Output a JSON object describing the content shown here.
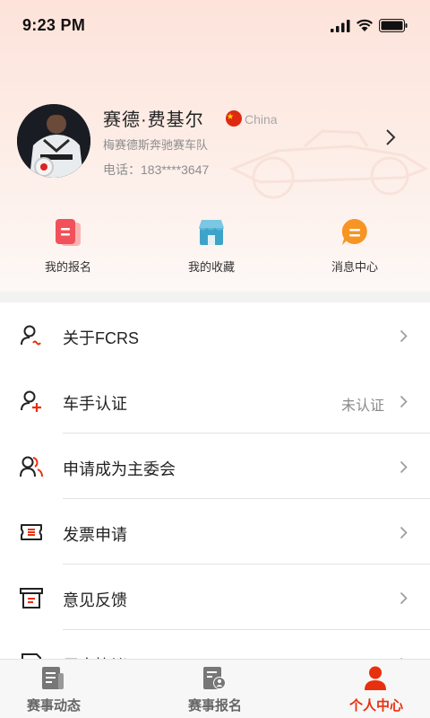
{
  "status_bar": {
    "time": "9:23 PM"
  },
  "profile": {
    "name": "赛德·费基尔",
    "country": "China",
    "team": "梅赛德斯奔驰赛车队",
    "phone": "电话：183****3647"
  },
  "quick_actions": [
    {
      "label": "我的报名",
      "icon": "registration-icon"
    },
    {
      "label": "我的收藏",
      "icon": "favorites-store-icon"
    },
    {
      "label": "消息中心",
      "icon": "message-icon"
    }
  ],
  "menu": [
    {
      "label": "关于FCRS",
      "status": "",
      "icon": "about-user-icon"
    },
    {
      "label": "车手认证",
      "status": "未认证",
      "icon": "driver-certify-icon"
    },
    {
      "label": "申请成为主委会",
      "status": "",
      "icon": "committee-users-icon"
    },
    {
      "label": "发票申请",
      "status": "",
      "icon": "invoice-icon"
    },
    {
      "label": "意见反馈",
      "status": "",
      "icon": "feedback-icon"
    },
    {
      "label": "用户协议",
      "status": "",
      "icon": "agreement-icon"
    }
  ],
  "tabbar": [
    {
      "label": "赛事动态",
      "active": false,
      "icon": "news-icon"
    },
    {
      "label": "赛事报名",
      "active": false,
      "icon": "event-registration-icon"
    },
    {
      "label": "个人中心",
      "active": true,
      "icon": "person-icon"
    }
  ],
  "colors": {
    "accent": "#e8300e",
    "header_gradient_top": "#fde3da",
    "divider": "#e3e3e3"
  }
}
